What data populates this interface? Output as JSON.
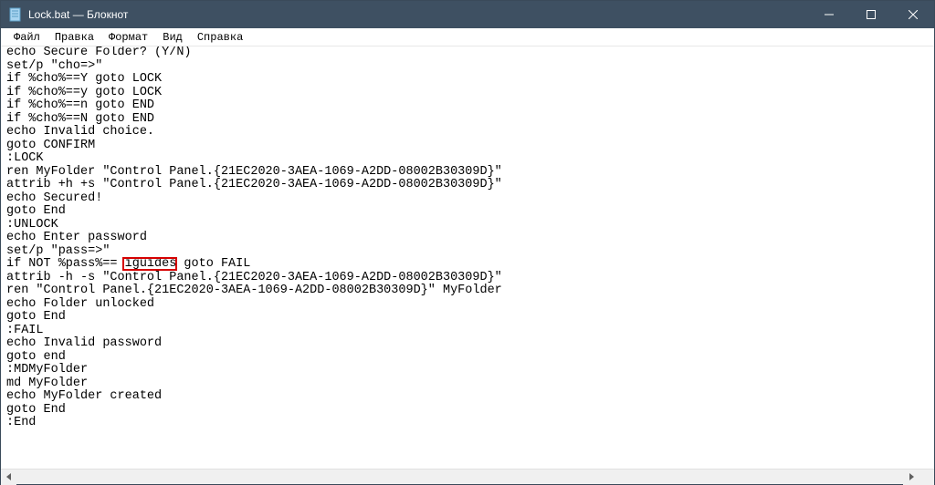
{
  "window": {
    "title": "Lock.bat — Блокнот"
  },
  "menu": {
    "file": "Файл",
    "edit": "Правка",
    "format": "Формат",
    "view": "Вид",
    "help": "Справка"
  },
  "content": {
    "lines": [
      "echo Secure Folder? (Y/N)",
      "set/p \"cho=>\"",
      "if %cho%==Y goto LOCK",
      "if %cho%==y goto LOCK",
      "if %cho%==n goto END",
      "if %cho%==N goto END",
      "echo Invalid choice.",
      "goto CONFIRM",
      ":LOCK",
      "ren MyFolder \"Control Panel.{21EC2020-3AEA-1069-A2DD-08002B30309D}\"",
      "attrib +h +s \"Control Panel.{21EC2020-3AEA-1069-A2DD-08002B30309D}\"",
      "echo Secured!",
      "goto End",
      ":UNLOCK",
      "echo Enter password",
      "set/p \"pass=>\"",
      "if NOT %pass%== iguides goto FAIL",
      "attrib -h -s \"Control Panel.{21EC2020-3AEA-1069-A2DD-08002B30309D}\"",
      "ren \"Control Panel.{21EC2020-3AEA-1069-A2DD-08002B30309D}\" MyFolder",
      "echo Folder unlocked",
      "goto End",
      ":FAIL",
      "echo Invalid password",
      "goto end",
      ":MDMyFolder",
      "md MyFolder",
      "echo MyFolder created",
      "goto End",
      ":End"
    ],
    "highlighted_text": "iguides",
    "highlighted_line_index": 16
  }
}
